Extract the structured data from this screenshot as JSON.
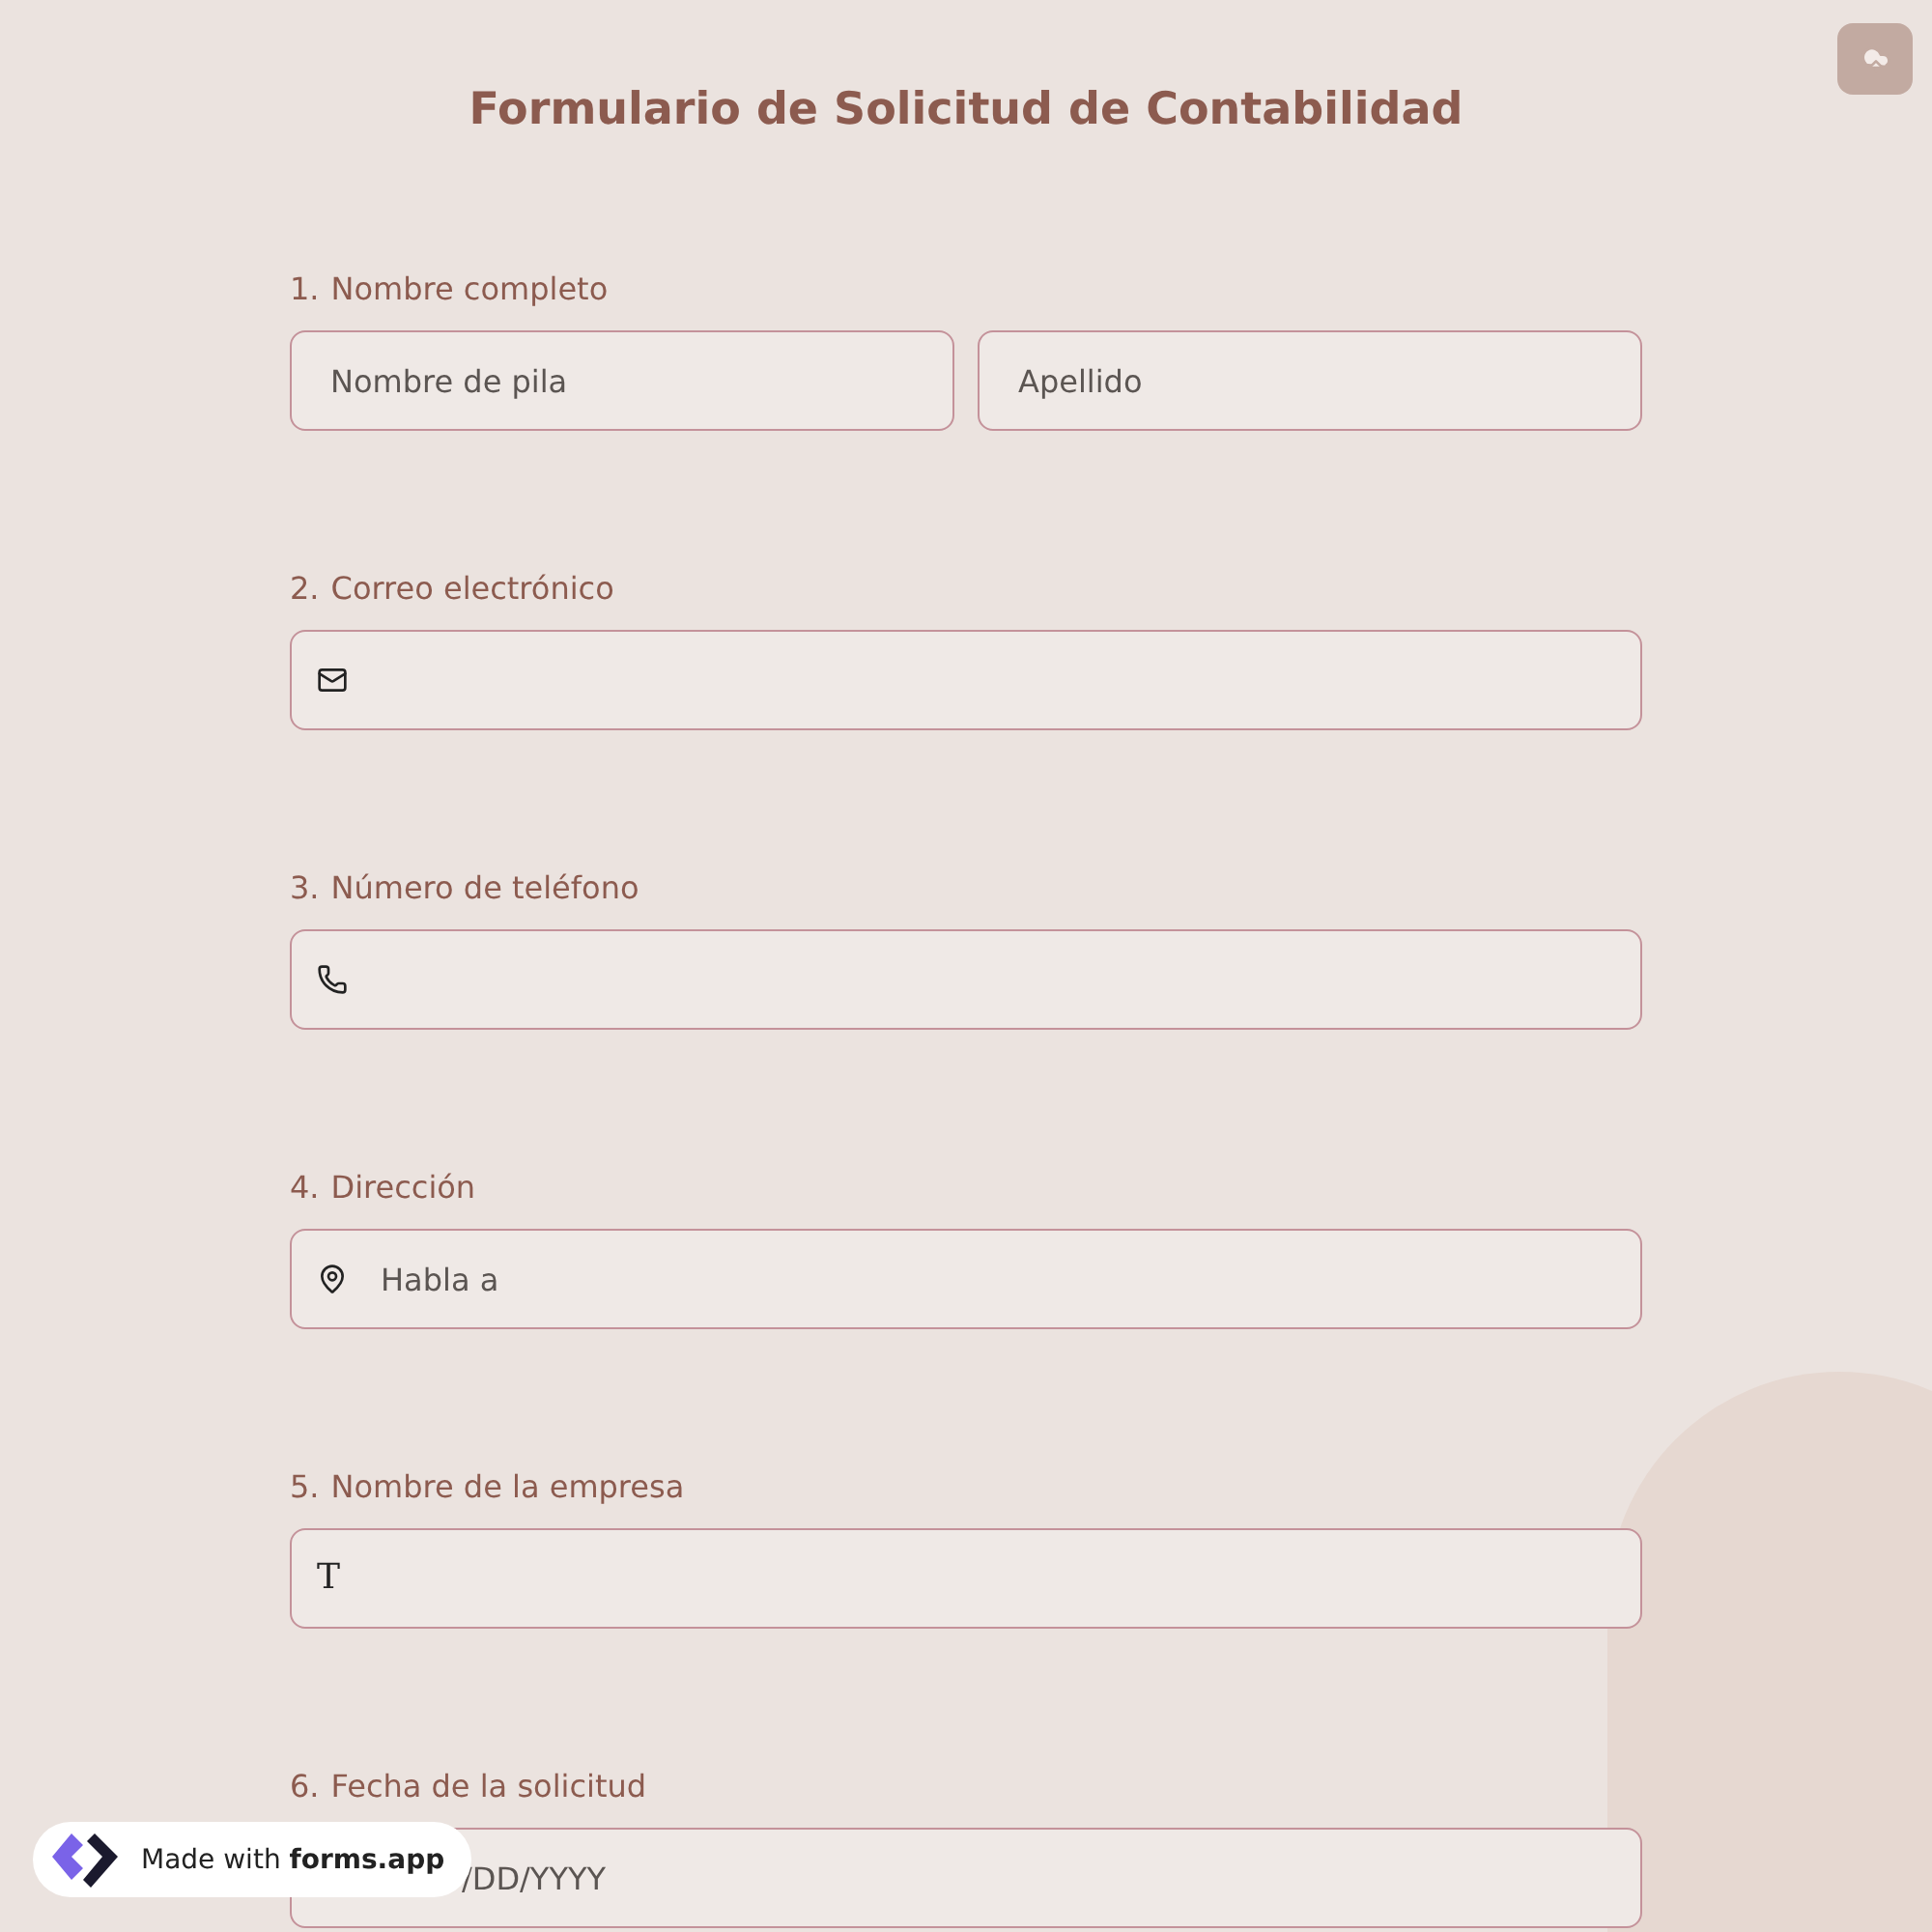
{
  "title": "Formulario de Solicitud de Contabilidad",
  "questions": [
    {
      "number": "1.",
      "label": "Nombre completo",
      "kind": "name",
      "fields": [
        {
          "placeholder": "Nombre de pila"
        },
        {
          "placeholder": "Apellido"
        }
      ]
    },
    {
      "number": "2.",
      "label": "Correo electrónico",
      "kind": "email"
    },
    {
      "number": "3.",
      "label": "Número de teléfono",
      "kind": "phone"
    },
    {
      "number": "4.",
      "label": "Dirección",
      "kind": "address",
      "fields": [
        {
          "placeholder": "Habla a"
        }
      ]
    },
    {
      "number": "5.",
      "label": "Nombre de la empresa",
      "kind": "text",
      "icon": "T"
    },
    {
      "number": "6.",
      "label": "Fecha de la solicitud",
      "kind": "date",
      "fields": [
        {
          "placeholder": "/DD/YYYY"
        }
      ]
    }
  ],
  "badge": {
    "text": "Made with **forms.app**"
  }
}
